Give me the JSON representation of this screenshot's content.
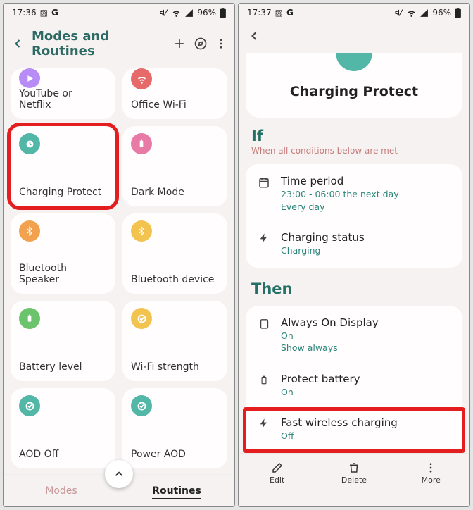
{
  "left": {
    "status": {
      "time": "17:36",
      "battery": "96%"
    },
    "header": {
      "title": "Modes and Routines"
    },
    "routines": [
      {
        "label": "YouTube or Netflix",
        "color": "#b88cf7",
        "icon": "play"
      },
      {
        "label": "Office Wi-Fi",
        "color": "#e66a6a",
        "icon": "wifi"
      },
      {
        "label": "Charging Protect",
        "color": "#52b7a7",
        "icon": "clock"
      },
      {
        "label": "Dark Mode",
        "color": "#e87aa6",
        "icon": "battery"
      },
      {
        "label": "Bluetooth Speaker",
        "color": "#f2a24f",
        "icon": "bluetooth"
      },
      {
        "label": "Bluetooth device",
        "color": "#f2c34f",
        "icon": "bluetooth"
      },
      {
        "label": "Battery level",
        "color": "#6bc46b",
        "icon": "battery"
      },
      {
        "label": "Wi-Fi strength",
        "color": "#f2c34f",
        "icon": "check"
      },
      {
        "label": "AOD Off",
        "color": "#52b7a7",
        "icon": "check"
      },
      {
        "label": "Power AOD",
        "color": "#52b7a7",
        "icon": "check"
      }
    ],
    "tabs": {
      "modes": "Modes",
      "routines": "Routines"
    }
  },
  "right": {
    "status": {
      "time": "17:37",
      "battery": "96%"
    },
    "hero": {
      "title": "Charging Protect"
    },
    "if": {
      "heading": "If",
      "sub": "When all conditions below are met",
      "items": [
        {
          "title": "Time period",
          "sub1": "23:00 - 06:00 the next day",
          "sub2": "Every day",
          "icon": "calendar"
        },
        {
          "title": "Charging status",
          "sub1": "Charging",
          "icon": "bolt"
        }
      ]
    },
    "then": {
      "heading": "Then",
      "items": [
        {
          "title": "Always On Display",
          "sub1": "On",
          "sub2": "Show always",
          "icon": "square"
        },
        {
          "title": "Protect battery",
          "sub1": "On",
          "icon": "battery"
        },
        {
          "title": "Fast wireless charging",
          "sub1": "Off",
          "icon": "bolt"
        }
      ]
    },
    "actions": {
      "edit": "Edit",
      "delete": "Delete",
      "more": "More"
    }
  }
}
